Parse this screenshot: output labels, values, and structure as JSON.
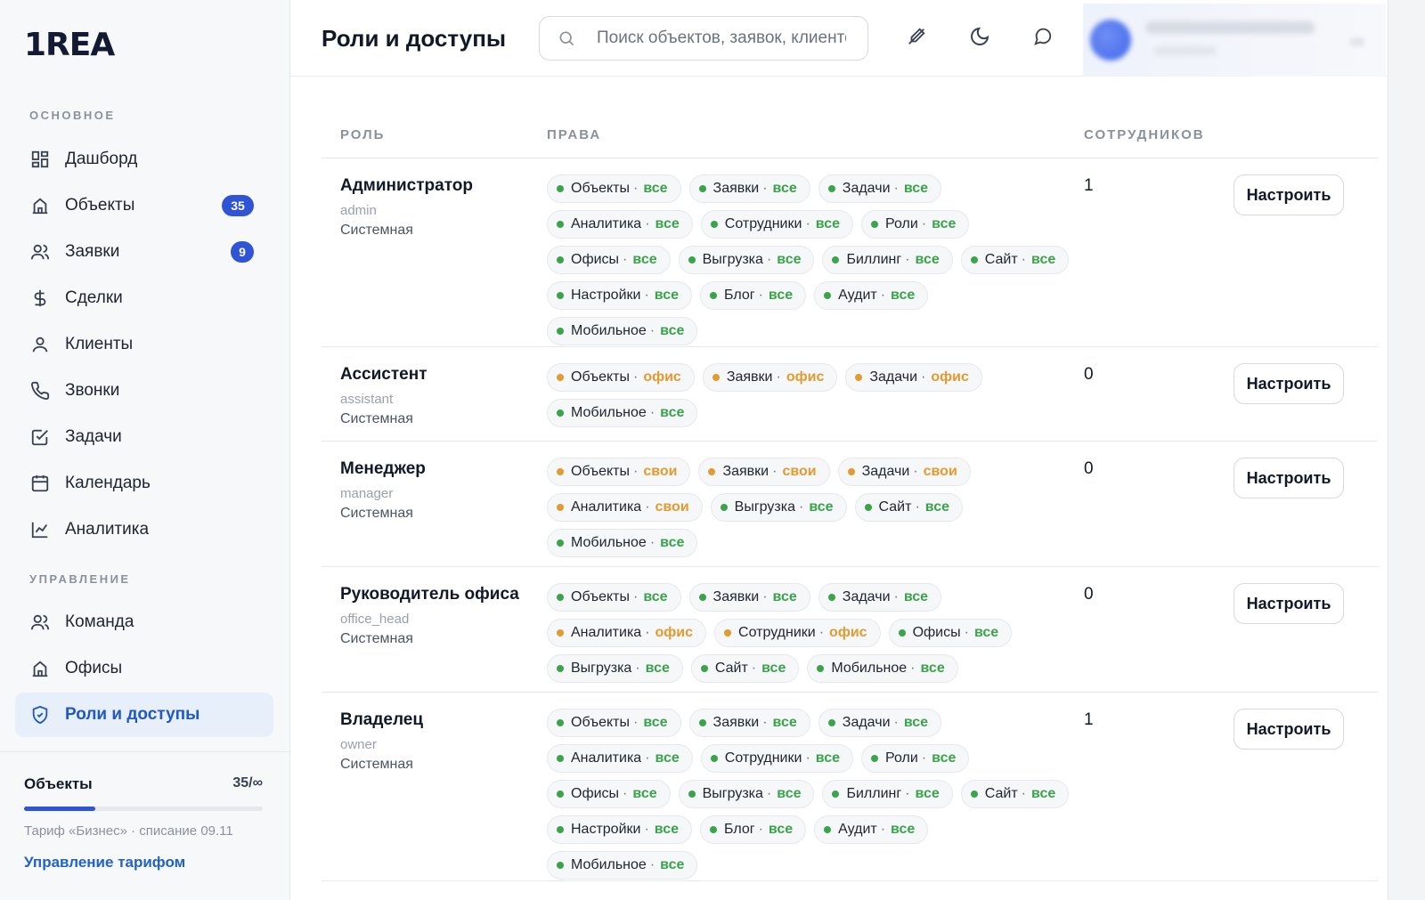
{
  "brand": {
    "logo_text": "1REA"
  },
  "sidebar": {
    "section_main": "ОСНОВНОЕ",
    "section_manage": "УПРАВЛЕНИЕ",
    "items": [
      {
        "label": "Дашборд"
      },
      {
        "label": "Объекты",
        "badge": "35"
      },
      {
        "label": "Заявки",
        "badge": "9"
      },
      {
        "label": "Сделки"
      },
      {
        "label": "Клиенты"
      },
      {
        "label": "Звонки"
      },
      {
        "label": "Задачи"
      },
      {
        "label": "Календарь"
      },
      {
        "label": "Аналитика"
      },
      {
        "label": "Команда"
      },
      {
        "label": "Офисы"
      },
      {
        "label": "Роли и доступы"
      }
    ],
    "footer": {
      "quota_label": "Объекты",
      "quota_value": "35/∞",
      "quota_fill_fraction": 0.3,
      "plan_text": "Тариф «Бизнес» · списание 09.11",
      "plan_link": "Управление тарифом"
    }
  },
  "header": {
    "title": "Роли и доступы",
    "search_placeholder": "Поиск объектов, заявок, клиентов",
    "icons": [
      "pen-off-icon",
      "moon-icon",
      "message-icon"
    ]
  },
  "colors": {
    "accent": "#2f54d6",
    "level_all": "#3aa34c",
    "level_limited": "#e39a2f"
  },
  "table": {
    "headers": {
      "role": "РОЛЬ",
      "rights": "ПРАВА",
      "staff": "СОТРУДНИКОВ"
    },
    "configure_label": "Настроить",
    "rows": [
      {
        "name": "Администратор",
        "code": "admin",
        "type": "Системная",
        "count": "1",
        "perms": [
          [
            "Объекты",
            "все"
          ],
          [
            "Заявки",
            "все"
          ],
          [
            "Задачи",
            "все"
          ],
          [
            "Аналитика",
            "все"
          ],
          [
            "Сотрудники",
            "все"
          ],
          [
            "Роли",
            "все"
          ],
          [
            "Офисы",
            "все"
          ],
          [
            "Выгрузка",
            "все"
          ],
          [
            "Биллинг",
            "все"
          ],
          [
            "Сайт",
            "все"
          ],
          [
            "Настройки",
            "все"
          ],
          [
            "Блог",
            "все"
          ],
          [
            "Аудит",
            "все"
          ],
          [
            "Мобильное",
            "все"
          ]
        ]
      },
      {
        "name": "Ассистент",
        "code": "assistant",
        "type": "Системная",
        "count": "0",
        "perms": [
          [
            "Объекты",
            "офис"
          ],
          [
            "Заявки",
            "офис"
          ],
          [
            "Задачи",
            "офис"
          ],
          [
            "Мобильное",
            "все"
          ]
        ]
      },
      {
        "name": "Менеджер",
        "code": "manager",
        "type": "Системная",
        "count": "0",
        "perms": [
          [
            "Объекты",
            "свои"
          ],
          [
            "Заявки",
            "свои"
          ],
          [
            "Задачи",
            "свои"
          ],
          [
            "Аналитика",
            "свои"
          ],
          [
            "Выгрузка",
            "все"
          ],
          [
            "Сайт",
            "все"
          ],
          [
            "Мобильное",
            "все"
          ]
        ]
      },
      {
        "name": "Руководитель офиса",
        "code": "office_head",
        "type": "Системная",
        "count": "0",
        "perms": [
          [
            "Объекты",
            "все"
          ],
          [
            "Заявки",
            "все"
          ],
          [
            "Задачи",
            "все"
          ],
          [
            "Аналитика",
            "офис"
          ],
          [
            "Сотрудники",
            "офис"
          ],
          [
            "Офисы",
            "все"
          ],
          [
            "Выгрузка",
            "все"
          ],
          [
            "Сайт",
            "все"
          ],
          [
            "Мобильное",
            "все"
          ]
        ]
      },
      {
        "name": "Владелец",
        "code": "owner",
        "type": "Системная",
        "count": "1",
        "perms": [
          [
            "Объекты",
            "все"
          ],
          [
            "Заявки",
            "все"
          ],
          [
            "Задачи",
            "все"
          ],
          [
            "Аналитика",
            "все"
          ],
          [
            "Сотрудники",
            "все"
          ],
          [
            "Роли",
            "все"
          ],
          [
            "Офисы",
            "все"
          ],
          [
            "Выгрузка",
            "все"
          ],
          [
            "Биллинг",
            "все"
          ],
          [
            "Сайт",
            "все"
          ],
          [
            "Настройки",
            "все"
          ],
          [
            "Блог",
            "все"
          ],
          [
            "Аудит",
            "все"
          ],
          [
            "Мобильное",
            "все"
          ]
        ]
      }
    ]
  }
}
